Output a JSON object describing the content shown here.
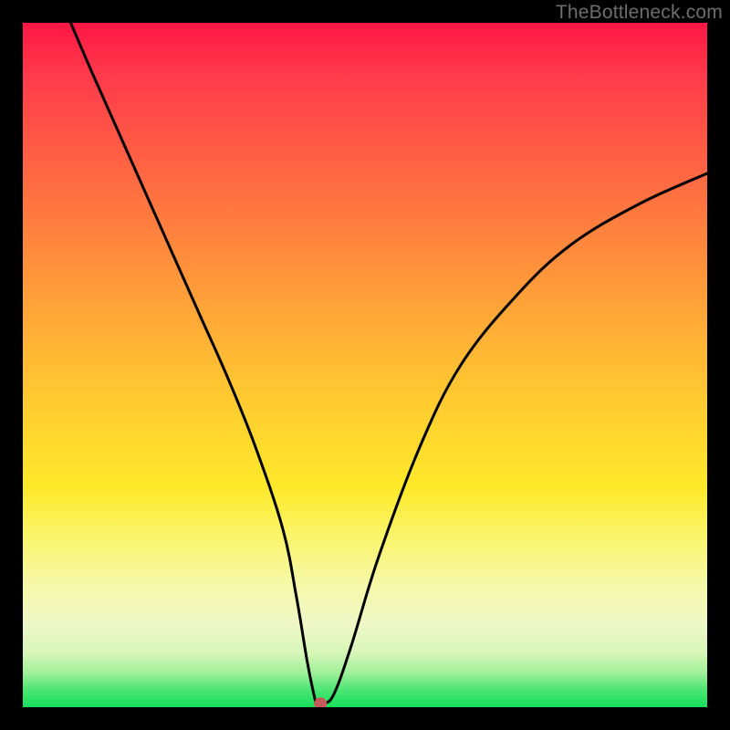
{
  "watermark": "TheBottleneck.com",
  "chart_data": {
    "type": "line",
    "title": "",
    "xlabel": "",
    "ylabel": "",
    "xlim": [
      0,
      100
    ],
    "ylim": [
      0,
      100
    ],
    "grid": false,
    "legend": false,
    "series": [
      {
        "name": "bottleneck-curve",
        "x": [
          7,
          10,
          14,
          18,
          22,
          26,
          30,
          34,
          38,
          40,
          41.5,
          42.5,
          43,
          44,
          45.5,
          48,
          52,
          58,
          64,
          72,
          80,
          90,
          100
        ],
        "y": [
          100,
          93,
          84,
          75,
          66,
          57,
          48,
          38,
          26,
          16,
          7,
          2,
          0.5,
          0.5,
          2,
          9,
          22,
          38,
          50,
          60,
          67.5,
          73.5,
          78
        ]
      }
    ],
    "marker": {
      "x": 43.5,
      "y": 0.5,
      "color": "#c45a5a",
      "radius_px": 7
    },
    "gradient_stops": [
      {
        "pos": 0.0,
        "color": "#ff1744"
      },
      {
        "pos": 0.28,
        "color": "#ff7a3f"
      },
      {
        "pos": 0.58,
        "color": "#ffd22f"
      },
      {
        "pos": 0.82,
        "color": "#f6f8a8"
      },
      {
        "pos": 0.95,
        "color": "#9ff09a"
      },
      {
        "pos": 1.0,
        "color": "#16df5a"
      }
    ]
  }
}
